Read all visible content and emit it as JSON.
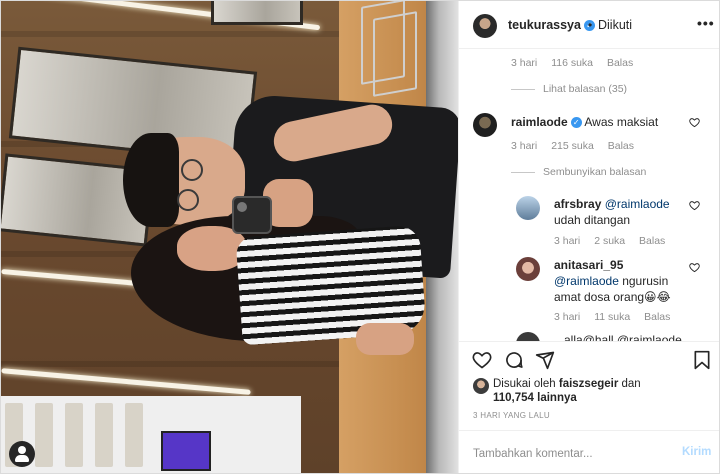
{
  "header": {
    "username": "teukurassya",
    "separator": "•",
    "follow_status": "Diikuti",
    "more": "•••"
  },
  "comments": {
    "top_meta": {
      "time": "3 hari",
      "likes": "116 suka",
      "reply": "Balas"
    },
    "view_replies": "Lihat balasan (35)",
    "main": {
      "username": "raimlaode",
      "text": "Awas maksiat",
      "time": "3 hari",
      "likes": "215 suka",
      "reply": "Balas",
      "hide_replies": "Sembunyikan balasan"
    },
    "replies": [
      {
        "username": "afrsbray",
        "mention": "@raimlaode",
        "text": "udah ditangan",
        "time": "3 hari",
        "likes": "2 suka",
        "reply": "Balas"
      },
      {
        "username": "anitasari_95",
        "mention": "@raimlaode",
        "text_line1": " ngurusin",
        "text_line2": "amat dosa orang😀😂",
        "time": "3 hari",
        "likes": "11 suka",
        "reply": "Balas"
      }
    ],
    "partial_next": "...alla@hall @raimlaode"
  },
  "actions": {
    "liked_by_prefix": "Disukai oleh",
    "liked_by_user": "faiszsegeir",
    "liked_by_and": "dan",
    "liked_by_count": "110,754 lainnya",
    "date": "3 HARI YANG LALU"
  },
  "comment_box": {
    "placeholder": "Tambahkan komentar...",
    "post_label": "Kirim"
  },
  "colors": {
    "verified": "#3897f0",
    "muted": "#8e8e8e",
    "mention": "#00376b",
    "post_button_disabled": "#b3dbff"
  },
  "icons": [
    "heart-icon",
    "comment-icon",
    "share-icon",
    "bookmark-icon",
    "more-icon",
    "verified-icon",
    "user-icon"
  ]
}
